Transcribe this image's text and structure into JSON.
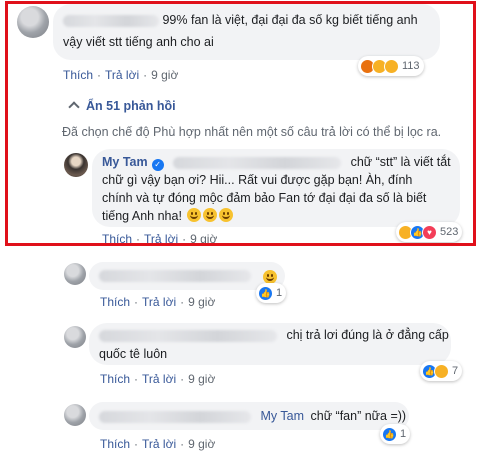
{
  "actions": {
    "like": "Thích",
    "reply": "Trả lời",
    "sep": "·"
  },
  "comment1": {
    "line1": "99% fan là việt, đại đại đa số kg biết tiếng anh",
    "line2": "vậy viết stt tiếng anh cho ai",
    "time": "9 giờ",
    "reactions": [
      "angry-icon",
      "haha-icon",
      "sad-icon"
    ],
    "count": "113"
  },
  "replies_toggle": {
    "icon": "chevron-up-icon",
    "label": "Ẩn 51 phản hồi"
  },
  "notice": "Đã chọn chế độ Phù hợp nhất nên một số câu trả lời có thể bị lọc ra.",
  "comment2": {
    "author": "My Tam",
    "verified_icon": "verified-badge-icon",
    "line1_tail": "chữ “stt” là viết tắt",
    "line2": "chữ gì vậy bạn ơi? Hii... Rất vui được gặp bạn! Àh, đính",
    "line3": "chính và tự đóng mộc đảm bảo Fan tớ đại đại đa số là biết",
    "line4": "tiếng Anh nha!",
    "time": "9 giờ",
    "reactions": [
      "haha-icon",
      "like-icon",
      "love-icon"
    ],
    "count": "523"
  },
  "reply1": {
    "time": "9 giờ",
    "count": "1"
  },
  "reply2": {
    "line1_tail": "chị trả lơi đúng là ở đẳng cấp",
    "line2": "quốc tê luôn",
    "time": "9 giờ",
    "count": "7"
  },
  "reply3": {
    "tag": "My Tam",
    "text": "chữ “fan” nữa =))",
    "time": "9 giờ",
    "count": "1"
  },
  "colors": {
    "highlight_border": "#e0101a",
    "link": "#385898",
    "bubble": "#f2f3f5"
  }
}
